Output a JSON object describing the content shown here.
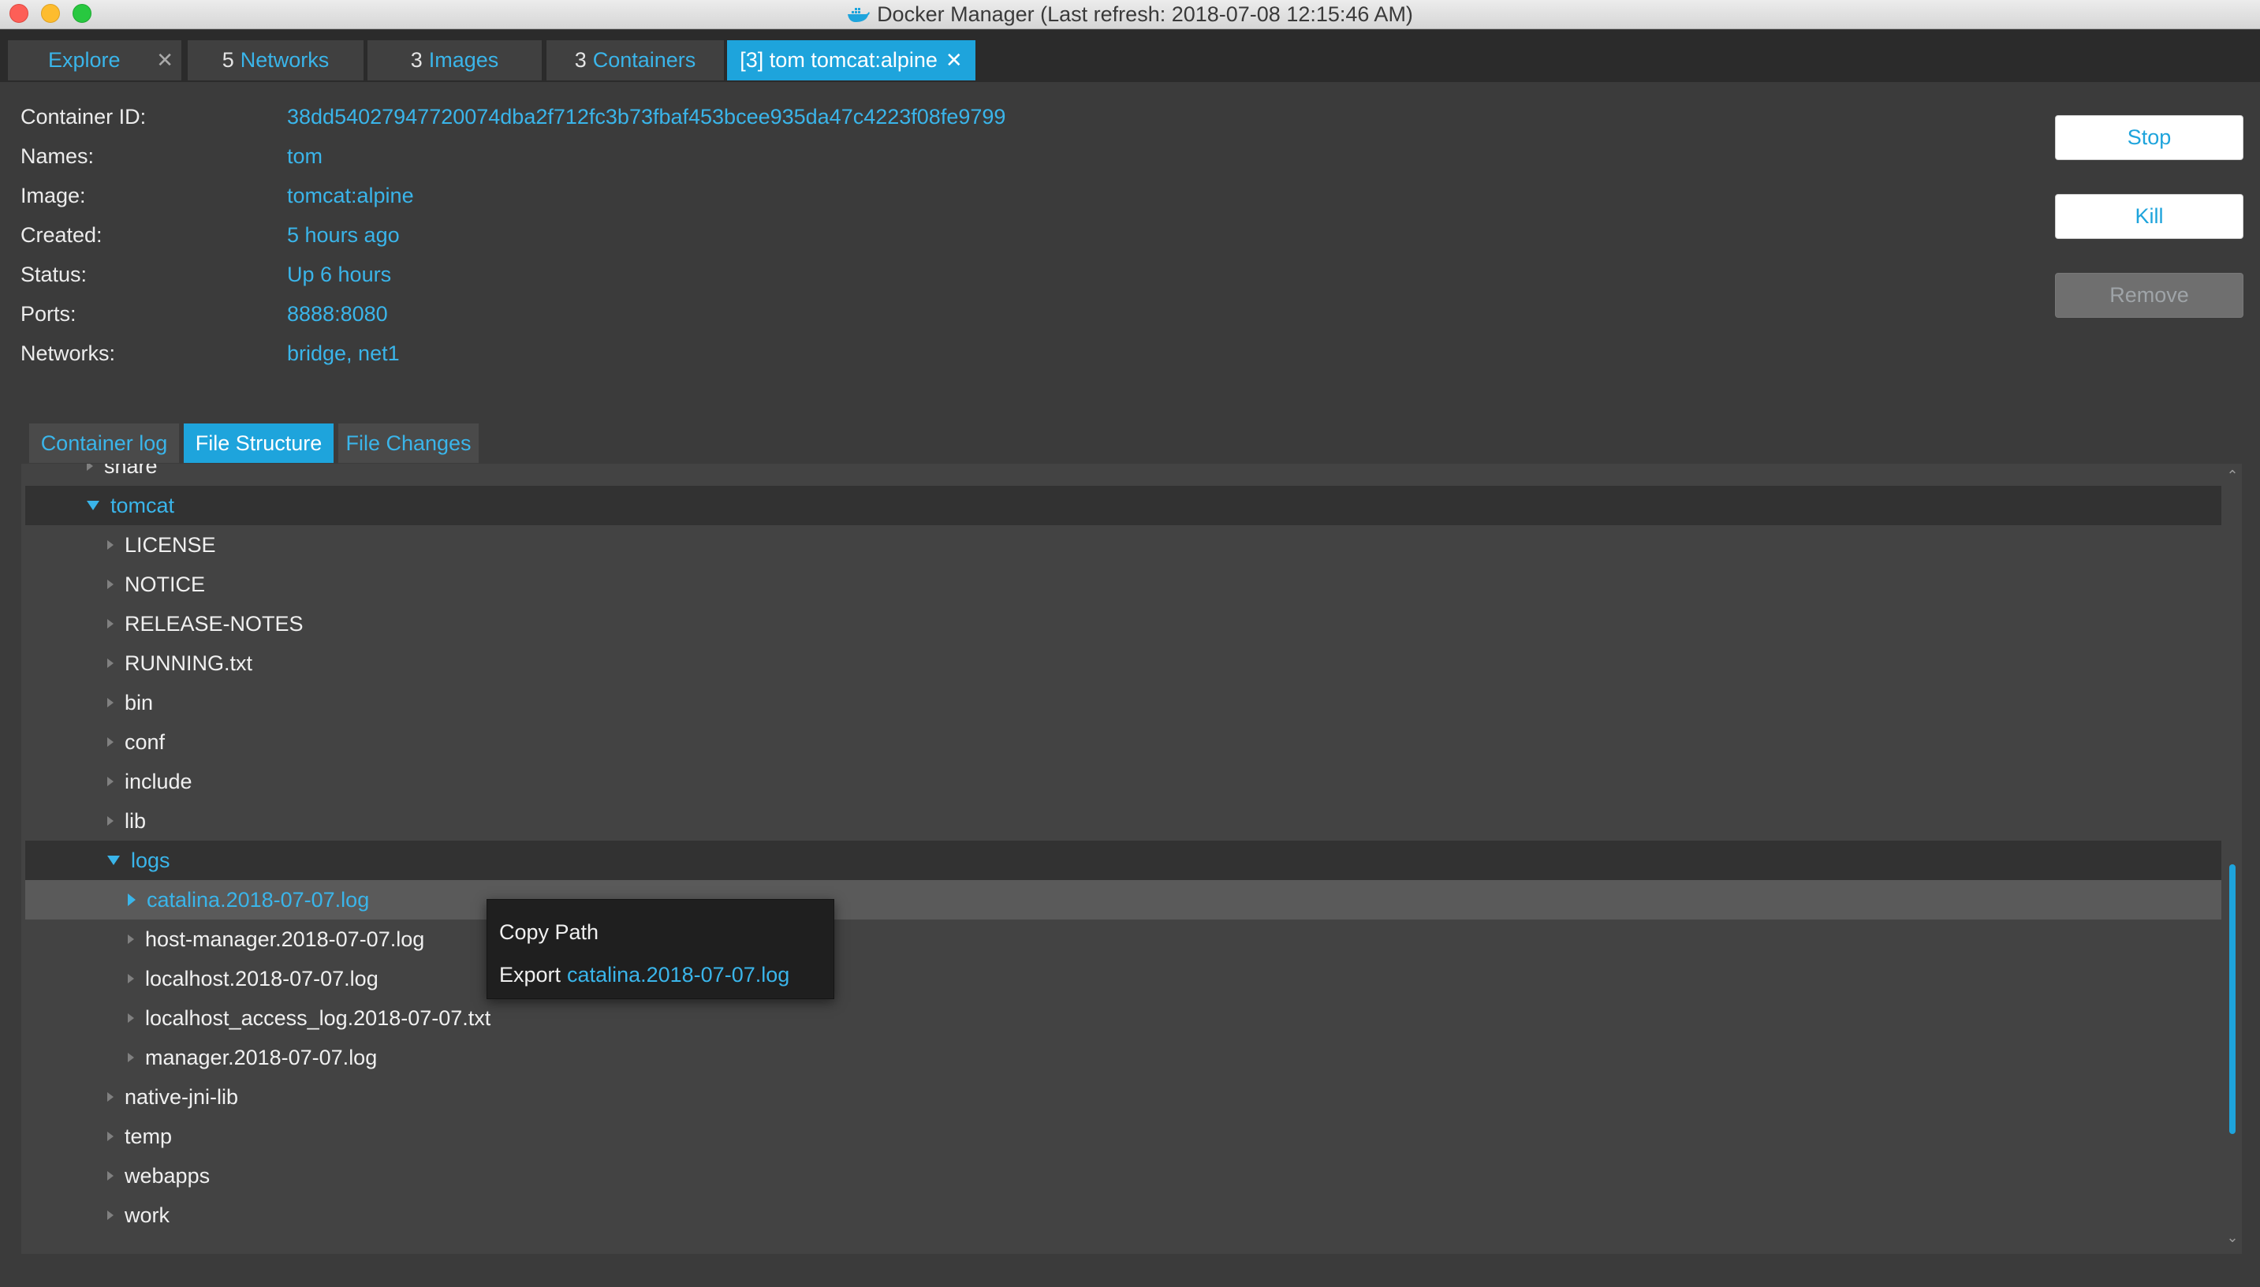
{
  "window": {
    "title": "Docker Manager (Last refresh: 2018-07-08 12:15:46 AM)"
  },
  "main_tabs": {
    "explore": {
      "label": "Explore",
      "close": "✕"
    },
    "networks": {
      "count": "5",
      "label": "Networks"
    },
    "images": {
      "count": "3",
      "label": "Images"
    },
    "containers": {
      "count": "3",
      "label": "Containers"
    },
    "container_detail": {
      "label": "[3] tom tomcat:alpine",
      "close": "✕"
    }
  },
  "details": {
    "container_id": {
      "label": "Container ID:",
      "value": "38dd54027947720074dba2f712fc3b73fbaf453bcee935da47c4223f08fe9799"
    },
    "names": {
      "label": "Names:",
      "value": "tom"
    },
    "image": {
      "label": "Image:",
      "value": "tomcat:alpine"
    },
    "created": {
      "label": "Created:",
      "value": "5 hours ago"
    },
    "status": {
      "label": "Status:",
      "value": "Up 6 hours"
    },
    "ports": {
      "label": "Ports:",
      "value": "8888:8080"
    },
    "networks": {
      "label": "Networks:",
      "value": "bridge, net1"
    }
  },
  "actions": {
    "stop": "Stop",
    "kill": "Kill",
    "remove": "Remove"
  },
  "sub_tabs": {
    "container_log": "Container log",
    "file_structure": "File Structure",
    "file_changes": "File Changes"
  },
  "tree": {
    "items": [
      {
        "label": "share"
      },
      {
        "label": "tomcat"
      },
      {
        "label": "LICENSE"
      },
      {
        "label": "NOTICE"
      },
      {
        "label": "RELEASE-NOTES"
      },
      {
        "label": "RUNNING.txt"
      },
      {
        "label": "bin"
      },
      {
        "label": "conf"
      },
      {
        "label": "include"
      },
      {
        "label": "lib"
      },
      {
        "label": "logs"
      },
      {
        "label": "catalina.2018-07-07.log"
      },
      {
        "label": "host-manager.2018-07-07.log"
      },
      {
        "label": "localhost.2018-07-07.log"
      },
      {
        "label": "localhost_access_log.2018-07-07.txt"
      },
      {
        "label": "manager.2018-07-07.log"
      },
      {
        "label": "native-jni-lib"
      },
      {
        "label": "temp"
      },
      {
        "label": "webapps"
      },
      {
        "label": "work"
      }
    ]
  },
  "context_menu": {
    "copy_path": "Copy Path",
    "export_prefix": "Export",
    "export_target": "catalina.2018-07-07.log"
  },
  "colors": {
    "accent": "#1ea4dc",
    "link": "#3ab5ea",
    "background": "#3b3b3b",
    "tree_background": "#434343"
  }
}
